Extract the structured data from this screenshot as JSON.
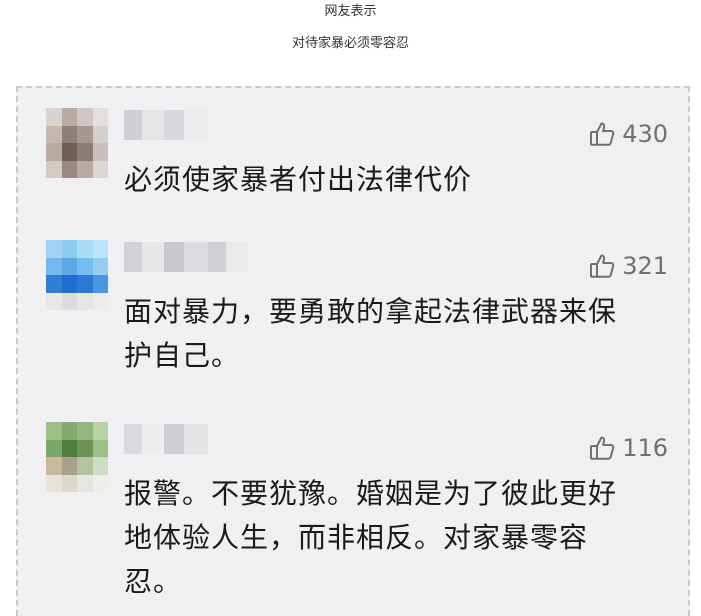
{
  "header": {
    "line1": "网友表示",
    "line2": "对待家暴必须零容忍"
  },
  "comments": [
    {
      "likes": "430",
      "text": "必须使家暴者付出法律代价",
      "avatar_colors": [
        "#d9d3d0",
        "#b8aba6",
        "#cfc7c3",
        "#e3dfdd",
        "#c5b8b2",
        "#8f7f79",
        "#a89893",
        "#d6cfcc",
        "#b9aaa4",
        "#6f5e58",
        "#8c7c76",
        "#c9bfbb",
        "#d3cac6",
        "#9a8983",
        "#b7a9a4",
        "#dcd6d3"
      ],
      "name_colors": [
        "#cfcfd3",
        "#e4e4e7",
        "#d8d8dc",
        "#ececef"
      ]
    },
    {
      "likes": "321",
      "text": "面对暴力，要勇敢的拿起法律武器来保护自己。",
      "avatar_colors": [
        "#9fd3f5",
        "#8ccaf2",
        "#a9dbf7",
        "#b9e3fa",
        "#74b8ec",
        "#5da9e6",
        "#78bced",
        "#96ccf2",
        "#2f7fd6",
        "#1f6fcf",
        "#2a78d4",
        "#4b95de",
        "#e7e7ea",
        "#dcdce0",
        "#e5e5e8",
        "#ececef"
      ],
      "name_colors": [
        "#d2d2d6",
        "#e6e6e9",
        "#c7c7cc",
        "#dcdce0",
        "#d0d0d4",
        "#e9e9ec"
      ]
    },
    {
      "likes": "116",
      "text": "报警。不要犹豫。婚姻是为了彼此更好地体验人生，而非相反。对家暴零容忍。",
      "avatar_colors": [
        "#9fbf86",
        "#83aa6b",
        "#93b77c",
        "#b9d0a8",
        "#7ea66a",
        "#4f7f3f",
        "#6c9458",
        "#9cc087",
        "#c9b99a",
        "#a9a08a",
        "#b5c2a0",
        "#d0dbc4",
        "#e8e3d9",
        "#ddd8cc",
        "#e6e6e0",
        "#eeeeeb"
      ],
      "name_colors": [
        "#dadade",
        "#ececef",
        "#cfcfd3",
        "#e3e3e6"
      ]
    }
  ]
}
